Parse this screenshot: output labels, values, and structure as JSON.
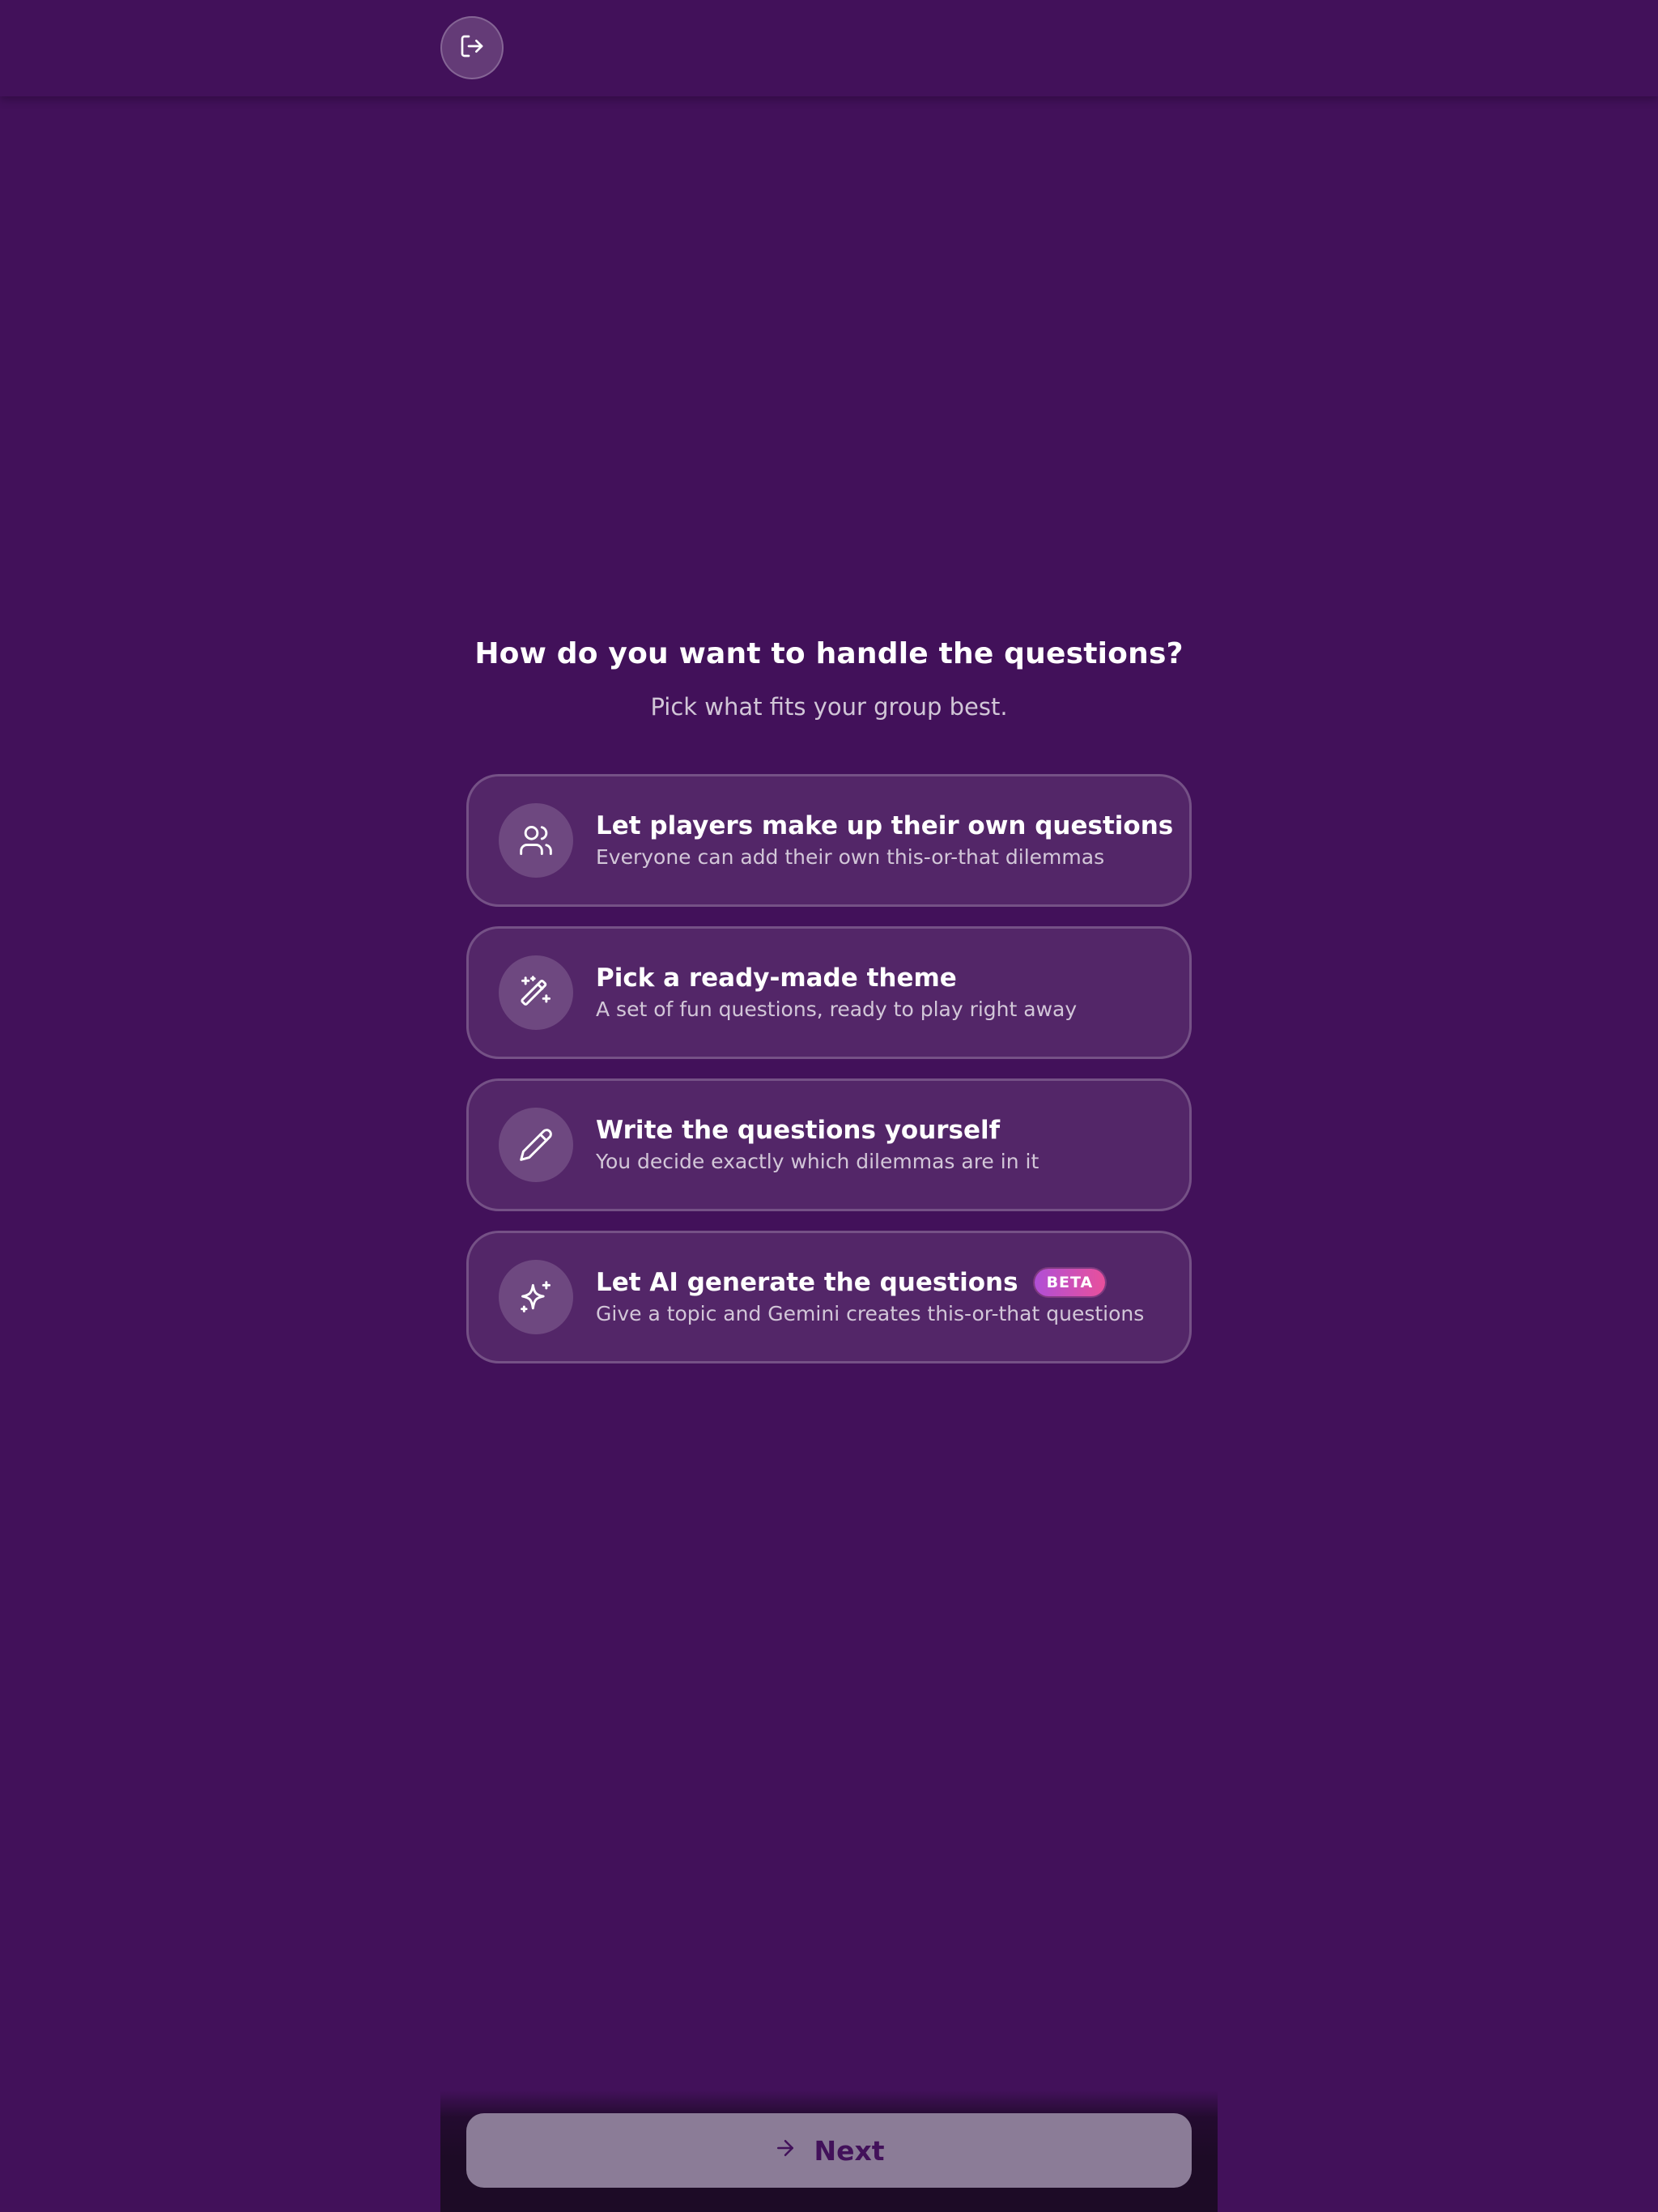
{
  "header": {
    "exit_icon": "log-out-icon"
  },
  "main": {
    "title": "How do you want to handle the questions?",
    "subtitle": "Pick what fits your group best.",
    "options": [
      {
        "icon": "users-icon",
        "title": "Let players make up their own questions",
        "description": "Everyone can add their own this-or-that dilemmas"
      },
      {
        "icon": "magic-wand-icon",
        "title": "Pick a ready-made theme",
        "description": "A set of fun questions, ready to play right away"
      },
      {
        "icon": "pencil-icon",
        "title": "Write the questions yourself",
        "description": "You decide exactly which dilemmas are in it"
      },
      {
        "icon": "sparkle-icon",
        "title": "Let AI generate the questions",
        "badge": "BETA",
        "description": "Give a topic and Gemini creates this-or-that questions"
      }
    ]
  },
  "footer": {
    "next_label": "Next",
    "next_icon": "arrow-right-icon"
  },
  "colors": {
    "background": "#42115a",
    "card_background": "rgba(255,255,255,0.09)",
    "next_button": "#8b7c97",
    "beta_gradient_start": "#b04fd6",
    "beta_gradient_end": "#e8509c"
  }
}
